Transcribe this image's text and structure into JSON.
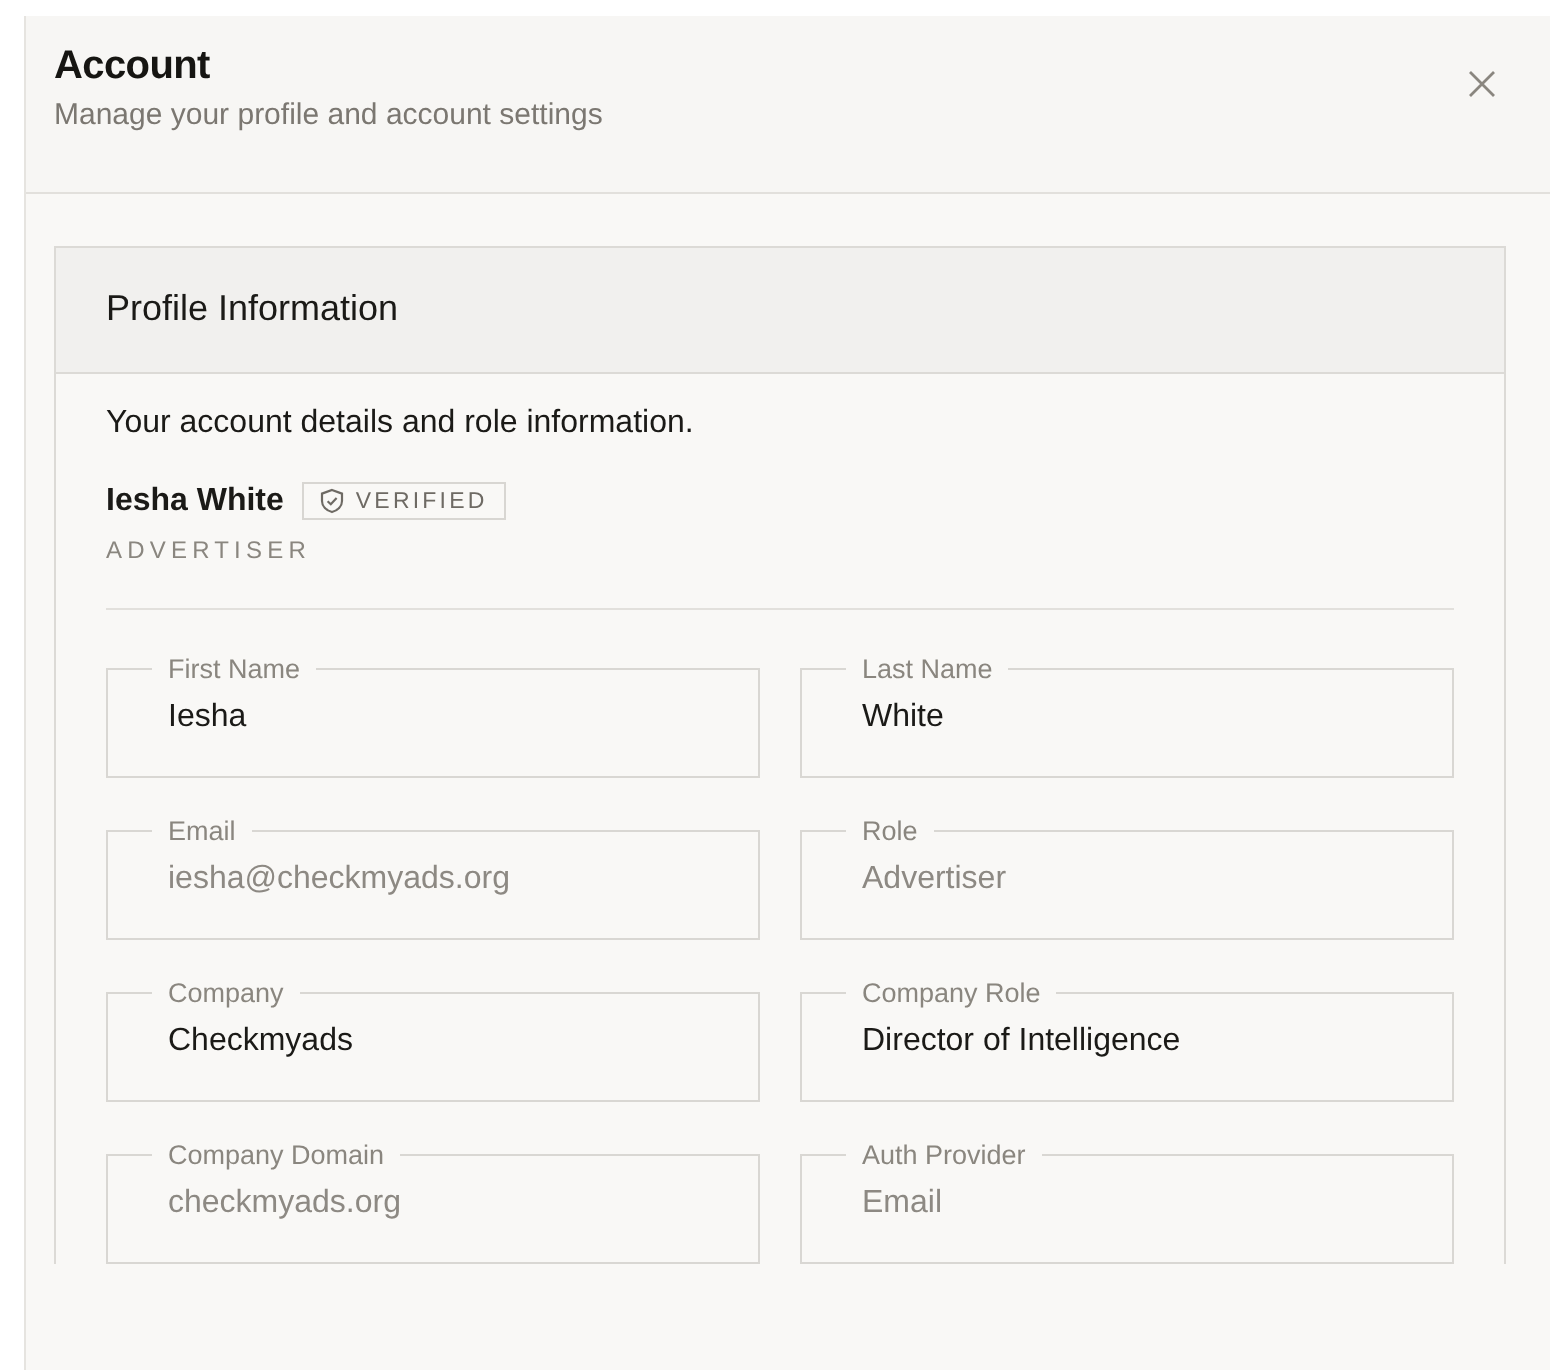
{
  "dialog": {
    "title": "Account",
    "subtitle": "Manage your profile and account settings"
  },
  "card": {
    "title": "Profile Information",
    "description": "Your account details and role information.",
    "name": "Iesha White",
    "badge": "VERIFIED",
    "role": "ADVERTISER"
  },
  "fields": [
    {
      "label": "First Name",
      "value": "Iesha",
      "disabled": false
    },
    {
      "label": "Last Name",
      "value": "White",
      "disabled": false
    },
    {
      "label": "Email",
      "value": "iesha@checkmyads.org",
      "disabled": true
    },
    {
      "label": "Role",
      "value": "Advertiser",
      "disabled": true
    },
    {
      "label": "Company",
      "value": "Checkmyads",
      "disabled": false
    },
    {
      "label": "Company Role",
      "value": "Director of Intelligence",
      "disabled": false
    },
    {
      "label": "Company Domain",
      "value": "checkmyads.org",
      "disabled": true
    },
    {
      "label": "Auth Provider",
      "value": "Email",
      "disabled": true
    }
  ]
}
